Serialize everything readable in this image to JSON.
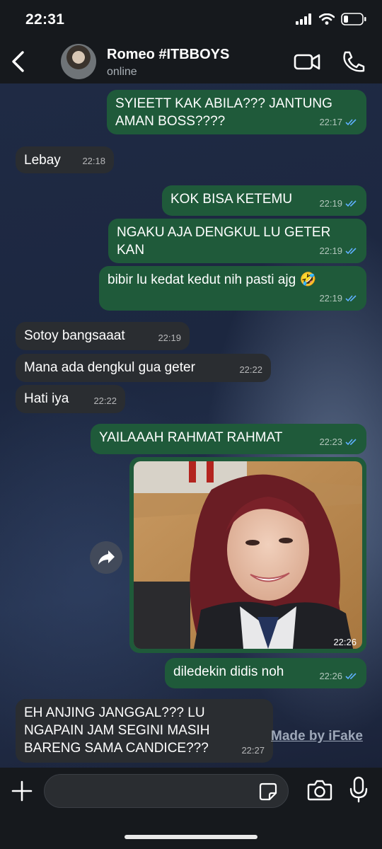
{
  "status_bar": {
    "time": "22:31"
  },
  "header": {
    "contact_name": "Romeo #ITBBOYS",
    "contact_status": "online",
    "icons": {
      "back": "chevron-left-icon",
      "video": "video-camera-icon",
      "call": "phone-icon"
    }
  },
  "messages": [
    {
      "dir": "out",
      "text": "SYIEETT KAK ABILA??? JANTUNG\nAMAN BOSS????",
      "time": "22:17",
      "read": true
    },
    {
      "dir": "in",
      "text": "Lebay",
      "time": "22:18"
    },
    {
      "dir": "out",
      "text": "KOK BISA KETEMU",
      "time": "22:19",
      "read": true
    },
    {
      "dir": "out",
      "text": "NGAKU AJA DENGKUL LU GETER\nKAN",
      "time": "22:19",
      "read": true
    },
    {
      "dir": "out",
      "text": "bibir lu kedat kedut nih pasti ajg 🤣",
      "time": "22:19",
      "read": true
    },
    {
      "dir": "in",
      "text": "Sotoy bangsaaat",
      "time": "22:19"
    },
    {
      "dir": "in",
      "text": "Mana ada dengkul gua geter",
      "time": "22:22"
    },
    {
      "dir": "in",
      "text": "Hati iya",
      "time": "22:22"
    },
    {
      "dir": "out",
      "text": "YAILAAAH RAHMAT RAHMAT",
      "time": "22:23",
      "read": true
    },
    {
      "dir": "out",
      "type": "image",
      "time": "22:26"
    },
    {
      "dir": "out",
      "text": "diledekin didis noh",
      "time": "22:26",
      "read": true
    },
    {
      "dir": "in",
      "text": "EH ANJING JANGGAL??? LU\nNGAPAIN JAM SEGINI MASIH\nBARENG SAMA CANDICE???",
      "time": "22:27"
    }
  ],
  "watermark": "Made by iFake",
  "composer": {
    "placeholder": ""
  },
  "colors": {
    "outgoing": "#1f5a3a",
    "incoming": "#2a2d31",
    "read_tick": "#5fb0ff",
    "bar": "#16191d"
  }
}
